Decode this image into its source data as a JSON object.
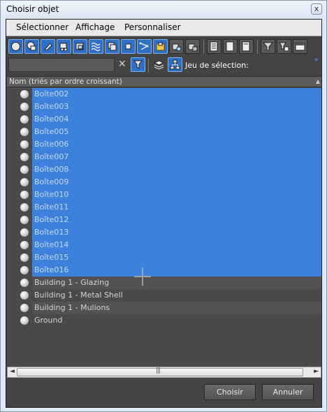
{
  "window": {
    "title": "Choisir objet",
    "close_glyph": "x"
  },
  "menu": [
    "Sélectionner",
    "Affichage",
    "Personnaliser"
  ],
  "toolbar1_icons": [
    "sphere-icon",
    "shapes-icon",
    "lights-icon",
    "cameras-icon",
    "helpers-icon",
    "spacewarps-icon",
    "groups-icon",
    "xrefs-icon",
    "bones-icon",
    "containers-icon",
    "frozen-icon",
    "hidden-icon",
    "list-all-icon",
    "list-none-icon",
    "list-invert-icon",
    "filter-icon",
    "filter-options-icon",
    "panel-icon"
  ],
  "toolbar2": {
    "search_value": "",
    "clear_glyph": "✕",
    "jeu_label": "Jeu de sélection:",
    "overflow_glyph": "»"
  },
  "list": {
    "header": "Nom (triés par ordre croissant)",
    "sort_glyph": "▲",
    "items": [
      {
        "label": "Boîte002",
        "selected": true
      },
      {
        "label": "Boîte003",
        "selected": true
      },
      {
        "label": "Boîte004",
        "selected": true
      },
      {
        "label": "Boîte005",
        "selected": true
      },
      {
        "label": "Boîte006",
        "selected": true
      },
      {
        "label": "Boîte007",
        "selected": true
      },
      {
        "label": "Boîte008",
        "selected": true
      },
      {
        "label": "Boîte009",
        "selected": true
      },
      {
        "label": "Boîte010",
        "selected": true
      },
      {
        "label": "Boîte011",
        "selected": true
      },
      {
        "label": "Boîte012",
        "selected": true
      },
      {
        "label": "Boîte013",
        "selected": true
      },
      {
        "label": "Boîte014",
        "selected": true
      },
      {
        "label": "Boîte015",
        "selected": true
      },
      {
        "label": "Boîte016",
        "selected": true
      },
      {
        "label": "Building 1 - Glazing",
        "selected": false
      },
      {
        "label": "Building 1 - Metal Shell",
        "selected": false
      },
      {
        "label": "Building 1 - Mulions",
        "selected": false
      },
      {
        "label": "Ground",
        "selected": false
      }
    ]
  },
  "scrollbar": {
    "left_glyph": "◄",
    "right_glyph": "►",
    "grip_glyph": "|||"
  },
  "buttons": {
    "ok": "Choisir",
    "cancel": "Annuler"
  },
  "colors": {
    "selection": "#3c82dc",
    "panel": "#444444",
    "active_button": "#2f6fc6"
  }
}
